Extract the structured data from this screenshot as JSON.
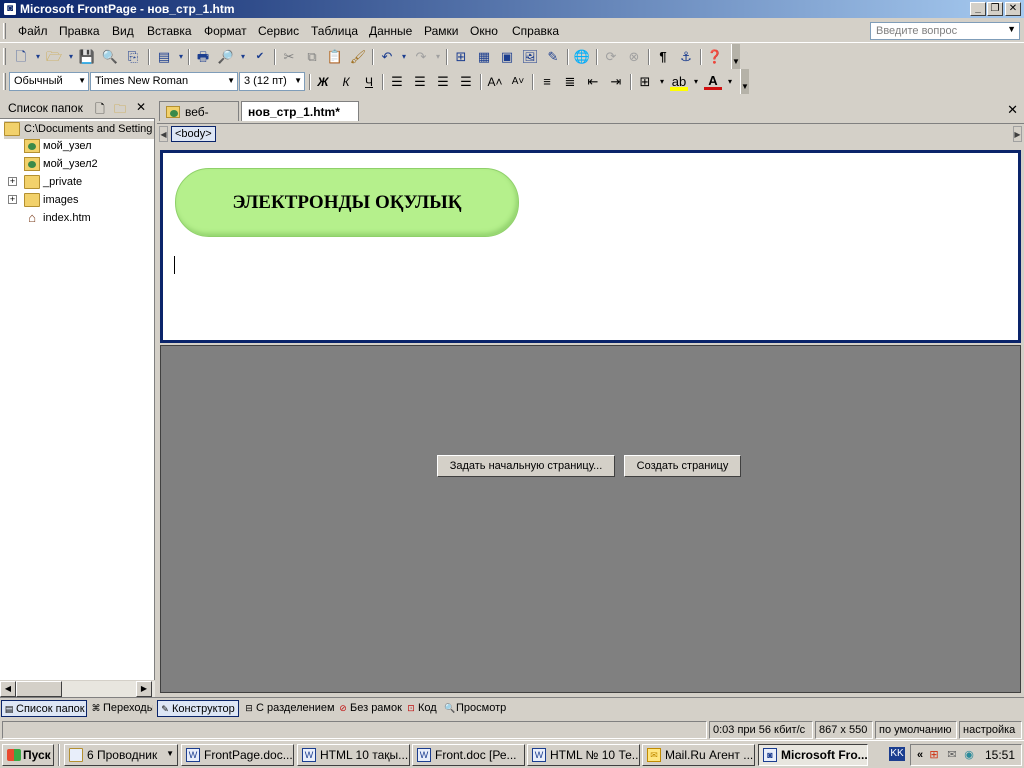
{
  "titlebar": {
    "title": "Microsoft FrontPage - нов_стр_1.htm",
    "app_icon": "frontpage-icon"
  },
  "menu": {
    "items": [
      "Файл",
      "Правка",
      "Вид",
      "Вставка",
      "Формат",
      "Сервис",
      "Таблица",
      "Данные",
      "Рамки",
      "Окно",
      "Справка"
    ],
    "ask_placeholder": "Введите вопрос"
  },
  "formatting": {
    "style": "Обычный",
    "font": "Times New Roman",
    "size": "3  (12 пт)",
    "bold_label": "Ж",
    "italic_label": "К",
    "underline_label": "Ч"
  },
  "folder_pane": {
    "title": "Список папок",
    "items": [
      {
        "label": "C:\\Documents and Setting",
        "icon": "folder-icon"
      },
      {
        "label": "мой_узел",
        "icon": "web-folder-icon"
      },
      {
        "label": "мой_узел2",
        "icon": "web-folder-icon"
      },
      {
        "label": "_private",
        "icon": "folder-icon"
      },
      {
        "label": "images",
        "icon": "folder-icon"
      },
      {
        "label": "index.htm",
        "icon": "home-page-icon"
      }
    ]
  },
  "doc_tabs": [
    {
      "label": "веб-узел",
      "active": false
    },
    {
      "label": "нов_стр_1.htm*",
      "active": true
    }
  ],
  "tag_selector": "<body>",
  "page": {
    "heading": "ЭЛЕКТРОНДЫ ОҚУЛЫҚ",
    "heading_bg": "#b5f08c"
  },
  "frame_buttons": {
    "set_initial": "Задать начальную страницу...",
    "new_page": "Создать страницу"
  },
  "view_tabs": {
    "left": [
      "Список папок",
      "Переходы"
    ],
    "right": [
      "Конструктор",
      "С разделением",
      "Без рамок",
      "Код",
      "Просмотр"
    ]
  },
  "status": {
    "speed": "0:03 при 56 кбит/с",
    "size": "867 x 550",
    "default": "по умолчанию",
    "custom": "настройка"
  },
  "taskbar": {
    "start": "Пуск",
    "buttons": [
      "6 Проводник",
      "FrontPage.doc...",
      "HTML 10 тақы...",
      "Front.doc [Ре...",
      "HTML № 10 Те...",
      "Mail.Ru Агент ...",
      "Microsoft Fro..."
    ],
    "lang": "KK",
    "clock": "15:51"
  }
}
